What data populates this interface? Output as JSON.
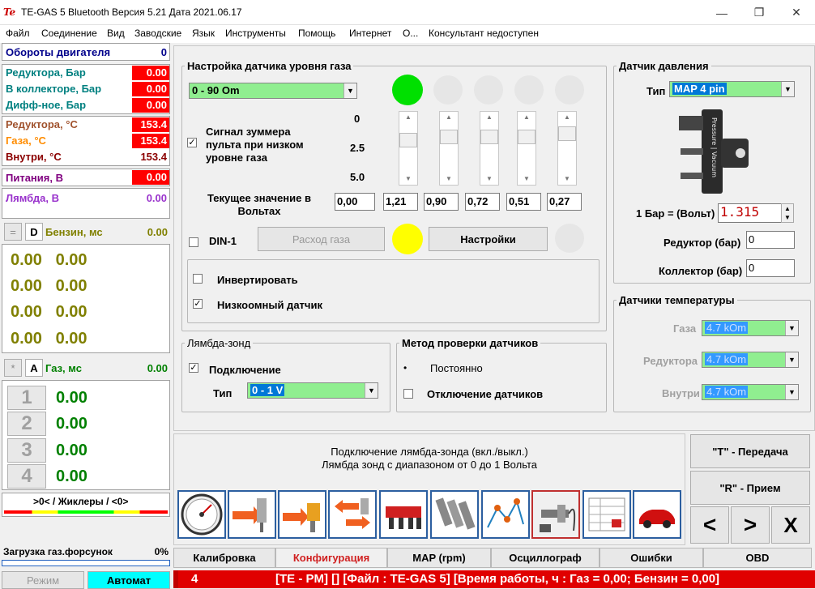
{
  "window": {
    "title": "TE-GAS 5 Bluetooth Версия 5.21  Дата 2021.06.17",
    "icon_text": "Te",
    "controls": [
      "minimize-icon",
      "restore-icon",
      "close-icon"
    ]
  },
  "menu": [
    "Файл",
    "Соединение",
    "Вид",
    "Заводские",
    "Язык",
    "Инструменты",
    "Помощь",
    "Интернет",
    "О...",
    "Консультант недоступен"
  ],
  "left": {
    "rpm": {
      "label": "Обороты двигателя",
      "value": "0"
    },
    "pressures": [
      {
        "label": "Редуктора, Бар",
        "value": "0.00"
      },
      {
        "label": "В коллекторе, Бар",
        "value": "0.00"
      },
      {
        "label": "Дифф-ное, Бар",
        "value": "0.00"
      }
    ],
    "temps": [
      {
        "label": "Редуктора, °C",
        "value": "153.4"
      },
      {
        "label": "Газа, °C",
        "value": "153.4"
      },
      {
        "label": "Внутри, °C",
        "value": "153.4"
      }
    ],
    "power": {
      "label": "Питания, В",
      "value": "0.00"
    },
    "lambda": {
      "label": "Лямбда, В",
      "value": "0.00"
    },
    "petrol": {
      "btn1": "=",
      "btn2": "D",
      "label": "Бензин, мс",
      "value": "0.00"
    },
    "petrol_rows": [
      [
        "0.00",
        "0.00"
      ],
      [
        "0.00",
        "0.00"
      ],
      [
        "0.00",
        "0.00"
      ],
      [
        "0.00",
        "0.00"
      ]
    ],
    "gas": {
      "btn1": "*",
      "btn2": "A",
      "label": "Газ, мс",
      "value": "0.00"
    },
    "gas_rows": [
      {
        "n": "1",
        "v": "0.00"
      },
      {
        "n": "2",
        "v": "0.00"
      },
      {
        "n": "3",
        "v": "0.00"
      },
      {
        "n": "4",
        "v": "0.00"
      }
    ],
    "jets": ">0< / Жиклеры / <0>",
    "injector_load": {
      "label": "Загрузка газ.форсунок",
      "value": "0%"
    },
    "mode_btn": "Режим",
    "auto_btn": "Автомат",
    "colors": {
      "red": "#ff0000",
      "yellow": "#ffff00",
      "green": "#00ff00"
    }
  },
  "level": {
    "title": "Настройка датчика уровня газа",
    "sensor_type": "0 - 90 Om",
    "buzzer_label": "Сигнал зуммера пульта при низком уровне газа",
    "scale": [
      "0",
      "2.5",
      "5.0"
    ],
    "current_label": "Текущее значение в Вольтах",
    "voltages": [
      "0,00",
      "1,21",
      "0,90",
      "0,72",
      "0,51",
      "0,27"
    ],
    "din_label": "DIN-1",
    "flow_btn": "Расход газа",
    "settings_btn": "Настройки",
    "invert_label": "Инвертировать",
    "low_ohm_label": "Низкоомный датчик",
    "led_colors": {
      "on": "#00e000",
      "yellow": "#ffff00",
      "off": "#e6e6e6"
    }
  },
  "lambda_group": {
    "title": "Лямбда-зонд",
    "connect_label": "Подключение",
    "type_label": "Тип",
    "type_value": "0 - 1 V"
  },
  "method": {
    "title": "Метод проверки датчиков",
    "opt1": "Постоянно",
    "opt2": "Отключение датчиков"
  },
  "pressure": {
    "title": "Датчик давления",
    "type_label": "Тип",
    "type_value": "MAP 4 pin",
    "sensor_text": "Pressure | Vacuum",
    "bar_volt_label": "1 Бар = (Вольт)",
    "bar_volt_value": "1.315",
    "reducer_label": "Редуктор (бар)",
    "reducer_value": "0",
    "collector_label": "Коллектор (бар)",
    "collector_value": "0"
  },
  "temp_sensors": {
    "title": "Датчики температуры",
    "rows": [
      {
        "label": "Газа",
        "value": "4.7 kOm"
      },
      {
        "label": "Редуктора",
        "value": "4.7 kOm"
      },
      {
        "label": "Внутри",
        "value": "4.7 kOm"
      }
    ]
  },
  "info": {
    "line1": "Подключение лямбда-зонда (вкл./выкл.)",
    "line2": "Лямбда зонд с диапазоном от 0 до 1 Вольта"
  },
  "transfer": {
    "send": "\"T\" - Передача",
    "receive": "\"R\" - Прием",
    "prev": "<",
    "next": ">",
    "close": "X"
  },
  "icons": [
    "gauge-icon",
    "gas-injector-icon",
    "fuel-pump-icon",
    "switch-fuel-icon",
    "injector-rail-icon",
    "injectors-icon",
    "graph-icon",
    "lambda-sensor-icon",
    "table-icon",
    "car-icon"
  ],
  "tabs": [
    "Калибровка",
    "Конфигурация",
    "MAP (rpm)",
    "Осциллограф",
    "Ошибки",
    "OBD"
  ],
  "active_tab": "Конфигурация",
  "status": {
    "num": "4",
    "text": "[TE - PM] [] [Файл : TE-GAS 5] [Время работы, ч : Газ = 0,00; Бензин = 0,00]"
  }
}
